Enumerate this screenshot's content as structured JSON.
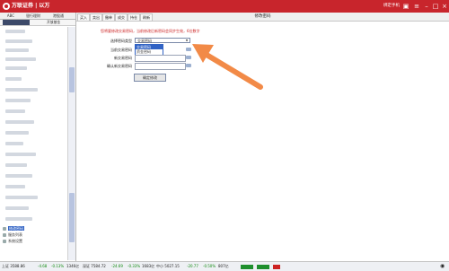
{
  "titlebar": {
    "brand": "万联证券 | 以万",
    "bind_phone": "绑定手机"
  },
  "sidebar": {
    "tabs": [
      "ABC",
      "银行理财",
      "港股通"
    ],
    "subtabs": [
      "",
      "开放基金"
    ],
    "tree": [
      {
        "label": "修改密码",
        "selected": true
      },
      {
        "label": "服务列表",
        "selected": false
      },
      {
        "label": "系统设置",
        "selected": false
      }
    ]
  },
  "toolbar": {
    "buttons": [
      "买入",
      "卖出",
      "撤单",
      "成交",
      "持仓",
      "刷新"
    ],
    "page_title": "修改密码"
  },
  "form": {
    "hint": "您将要修改交易密码，当前修改后新密码会同步生效，6位数字",
    "type_label": "选择密码类型",
    "type_value": "交易密码",
    "type_options": [
      "交易密码",
      "资金密码"
    ],
    "current_label": "当前交易密码",
    "new_label": "新交易密码",
    "confirm_label": "确认新交易密码",
    "confirm_button": "确定修改"
  },
  "colors": {
    "brand": "#c8252c",
    "arrow": "#f28a47",
    "selection": "#3163c5"
  },
  "status": {
    "sh": "上证 3588.86",
    "sh_chg": "-4.68",
    "sh_pct": "-0.13%",
    "sh_amt": "1346亿",
    "sz": "深证 7584.72",
    "sz_chg": "-24.69",
    "sz_pct": "-0.33%",
    "sz_amt": "1683亿",
    "cy": "中小 5027.15",
    "cy_chg": "-20.77",
    "cy_pct": "-0.50%",
    "cy_amt": "807亿"
  }
}
